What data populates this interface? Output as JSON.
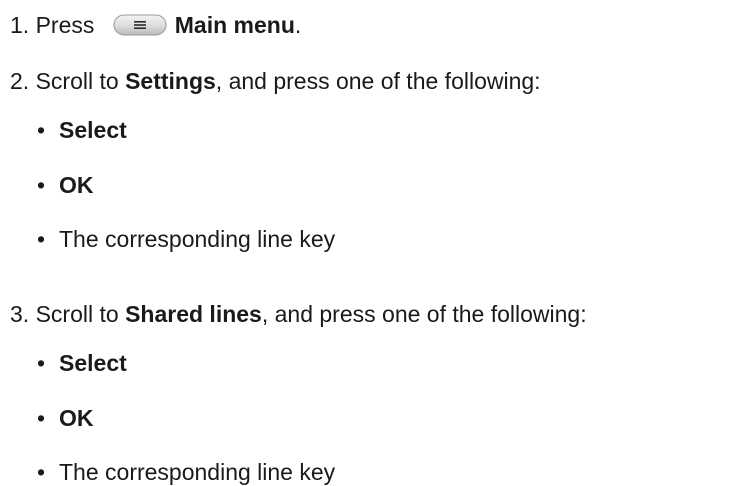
{
  "steps": [
    {
      "number": "1.",
      "pre": "Press ",
      "icon": "main-menu-key-icon",
      "bold": "Main menu",
      "post": "."
    },
    {
      "number": "2.",
      "pre": "Scroll to ",
      "bold": "Settings",
      "post": ", and press one of the following:",
      "bullets": [
        {
          "bold": "Select",
          "text": ""
        },
        {
          "bold": "OK",
          "text": ""
        },
        {
          "bold": "",
          "text": "The corresponding line key"
        }
      ]
    },
    {
      "number": "3.",
      "pre": "Scroll to ",
      "bold": "Shared lines",
      "post": ", and press one of the following:",
      "bullets": [
        {
          "bold": "Select",
          "text": ""
        },
        {
          "bold": "OK",
          "text": ""
        },
        {
          "bold": "",
          "text": "The corresponding line key"
        }
      ]
    }
  ],
  "bullet_char": "•"
}
